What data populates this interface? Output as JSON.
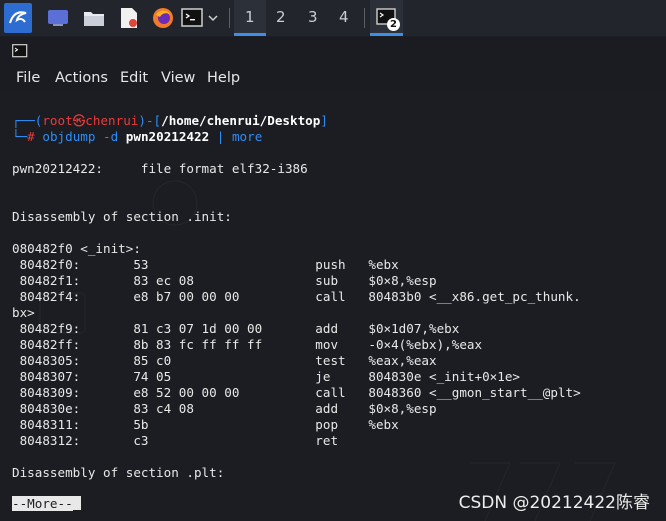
{
  "taskbar": {
    "workspaces": [
      "1",
      "2",
      "3",
      "4"
    ],
    "active_workspace": "1",
    "terminal_badge": "2"
  },
  "menubar": {
    "items": [
      "File",
      "Actions",
      "Edit",
      "View",
      "Help"
    ]
  },
  "prompt": {
    "user": "root",
    "at_symbol": "㉿",
    "host": "chenrui",
    "path": "/home/chenrui/Desktop",
    "command": "objdump -d",
    "argument": "pwn20212422",
    "pipe": "|",
    "pipe_command": "more"
  },
  "output_lines": [
    "pwn20212422:     file format elf32-i386",
    "",
    "",
    "Disassembly of section .init:",
    "",
    "080482f0 <_init>:",
    " 80482f0:       53                      push   %ebx",
    " 80482f1:       83 ec 08                sub    $0×8,%esp",
    " 80482f4:       e8 b7 00 00 00          call   80483b0 <__x86.get_pc_thunk.",
    "bx>",
    " 80482f9:       81 c3 07 1d 00 00       add    $0×1d07,%ebx",
    " 80482ff:       8b 83 fc ff ff ff       mov    -0×4(%ebx),%eax",
    " 8048305:       85 c0                   test   %eax,%eax",
    " 8048307:       74 05                   je     804830e <_init+0×1e>",
    " 8048309:       e8 52 00 00 00          call   8048360 <__gmon_start__@plt>",
    " 804830e:       83 c4 08                add    $0×8,%esp",
    " 8048311:       5b                      pop    %ebx",
    " 8048312:       c3                      ret",
    "",
    "Disassembly of section .plt:",
    ""
  ],
  "more_prompt": "--More--",
  "watermark": "CSDN @20212422陈睿",
  "colors": {
    "prompt_blue": "#2f8df5",
    "prompt_red": "#ea3b3b",
    "terminal_bg": "#1b1d22",
    "active_underline": "#3d8ee8"
  }
}
